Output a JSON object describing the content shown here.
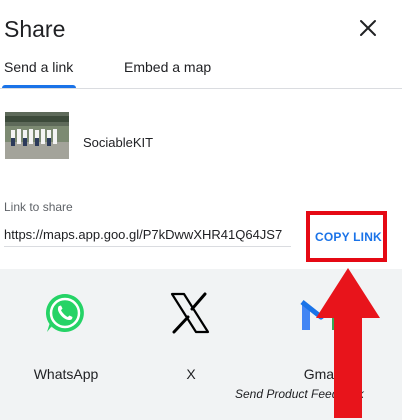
{
  "dialog": {
    "title": "Share"
  },
  "tabs": [
    {
      "label": "Send a link",
      "active": true
    },
    {
      "label": "Embed a map",
      "active": false
    }
  ],
  "place": {
    "name": "SociableKIT"
  },
  "link": {
    "label": "Link to share",
    "url": "https://maps.app.goo.gl/P7kDwwXHR41Q64JS7",
    "copy_label": "COPY LINK"
  },
  "share_targets": [
    {
      "label": "WhatsApp",
      "icon": "whatsapp-icon"
    },
    {
      "label": "X",
      "icon": "x-logo-icon"
    },
    {
      "label": "Gmail",
      "icon": "gmail-icon"
    }
  ],
  "feedback_label": "Send Product Feedback",
  "colors": {
    "accent": "#1a73e8",
    "highlight": "#e50914",
    "share_bg": "#f1f3f4",
    "whatsapp": "#25d366"
  }
}
